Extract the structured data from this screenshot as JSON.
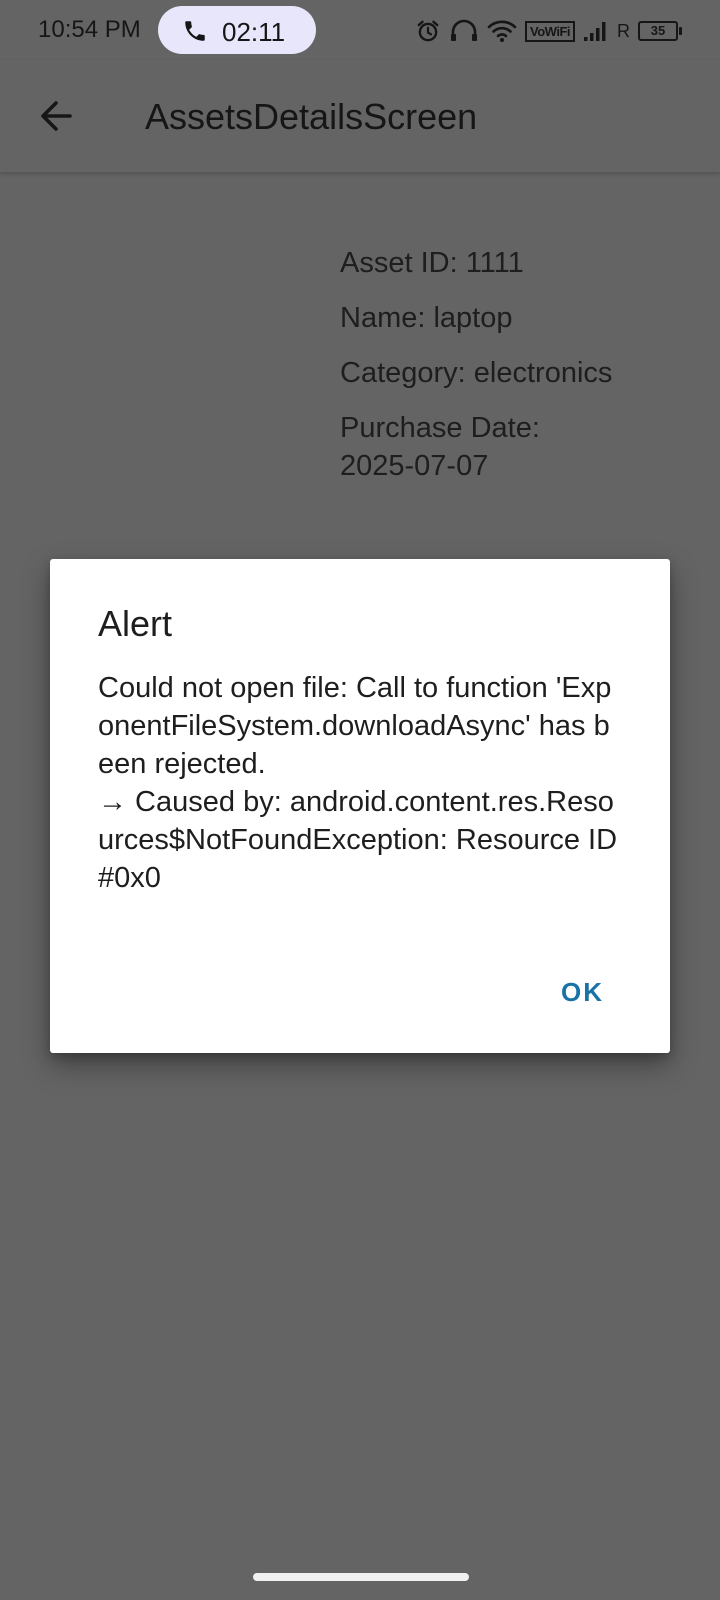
{
  "status_bar": {
    "time": "10:54 PM",
    "call_timer": "02:11",
    "vowifi": "VoWiFi",
    "roaming": "R",
    "battery": "35"
  },
  "app_bar": {
    "title": "AssetsDetailsScreen",
    "back_icon": "arrow-left-icon"
  },
  "details": {
    "asset_id": "Asset ID: 1111",
    "name": "Name: laptop",
    "category": "Category: electronics",
    "purchase_date_label": "Purchase Date:",
    "purchase_date_value": "2025-07-07"
  },
  "dialog": {
    "title": "Alert",
    "message": "Could not open file: Call to function 'ExponentFileSystem.downloadAsync' has been rejected.\n→ Caused by: android.content.res.Resources$NotFoundException: Resource ID #0x0",
    "ok_label": "OK"
  },
  "colors": {
    "scrim": "#646464",
    "dialog_bg": "#ffffff",
    "accent": "#1a73a8",
    "call_pill": "#e8e6fb"
  }
}
